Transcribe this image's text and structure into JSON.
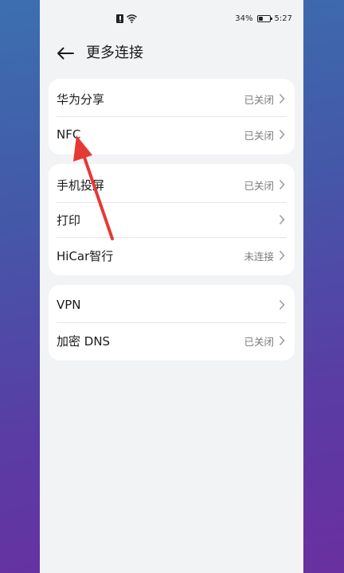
{
  "status_bar": {
    "battery": "34%",
    "battery_level": 0.34,
    "time": "5:27",
    "icons": [
      "alert-icon",
      "wifi-icon",
      "battery-icon"
    ]
  },
  "header": {
    "back_icon": "back-arrow-icon",
    "title": "更多连接"
  },
  "groups": [
    {
      "items": [
        {
          "label": "华为分享",
          "value": "已关闭"
        },
        {
          "label": "NFC",
          "value": "已关闭"
        }
      ]
    },
    {
      "items": [
        {
          "label": "手机投屏",
          "value": "已关闭"
        },
        {
          "label": "打印",
          "value": ""
        },
        {
          "label": "HiCar智行",
          "value": "未连接"
        }
      ]
    },
    {
      "items": [
        {
          "label": "VPN",
          "value": ""
        },
        {
          "label": "加密 DNS",
          "value": "已关闭"
        }
      ]
    }
  ],
  "annotation": {
    "icon": "red-pointer-arrow-icon",
    "color": "#e53935"
  },
  "colors": {
    "background": "#f1f3f5",
    "card": "#ffffff",
    "text": "#1a1a1a",
    "secondary_text": "#7a7a7a"
  }
}
